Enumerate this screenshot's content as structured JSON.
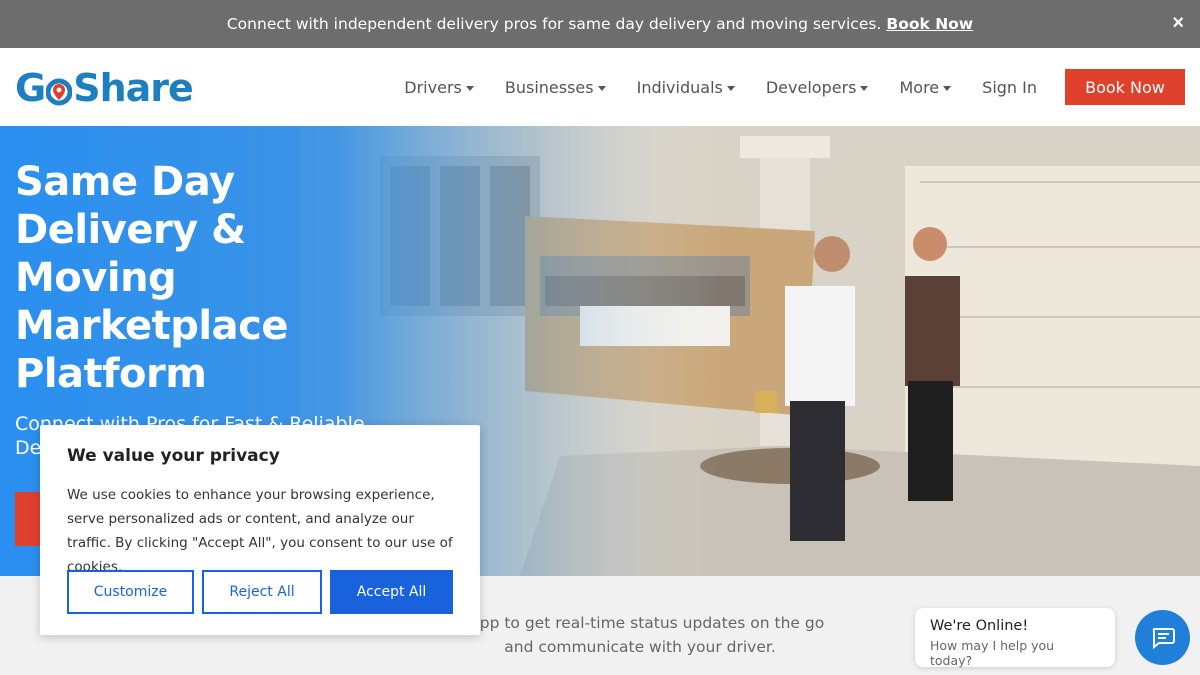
{
  "topbar": {
    "message": "Connect with independent delivery pros for same day delivery and moving services.",
    "book_label": "Book Now",
    "close_glyph": "×"
  },
  "header": {
    "logo_left": "G",
    "logo_right": "Share",
    "nav": [
      {
        "label": "Drivers",
        "dropdown": true
      },
      {
        "label": "Businesses",
        "dropdown": true
      },
      {
        "label": "Individuals",
        "dropdown": true
      },
      {
        "label": "Developers",
        "dropdown": true
      },
      {
        "label": "More",
        "dropdown": true
      }
    ],
    "signin_label": "Sign In",
    "book_label": "Book Now"
  },
  "hero": {
    "title": "Same Day Delivery & Moving Marketplace Platform",
    "subtitle": "Connect with Pros for Fast & Reliable De"
  },
  "below": {
    "text_line1": "e app to get real-time status updates on the go",
    "text_line2": "and communicate with your driver."
  },
  "cookie": {
    "title": "We value your privacy",
    "body": "We use cookies to enhance your browsing experience, serve personalized ads or content, and analyze our traffic. By clicking \"Accept All\", you consent to our use of cookies.",
    "customize_label": "Customize",
    "reject_label": "Reject All",
    "accept_label": "Accept All"
  },
  "chat": {
    "status": "We're Online!",
    "prompt": "How may I help you today?",
    "icon": "chat-icon"
  },
  "colors": {
    "brand_blue": "#1e7fc0",
    "accent_red": "#e0412d",
    "cookie_blue": "#1863dc",
    "topbar_gray": "#6d6d6d"
  }
}
